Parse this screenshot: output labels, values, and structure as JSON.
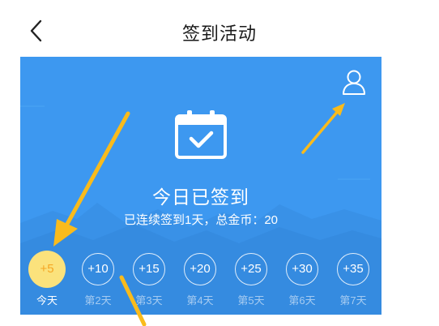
{
  "header": {
    "title": "签到活动",
    "back_icon": "chevron-left-icon"
  },
  "banner": {
    "background_color": "#3d98f0",
    "profile_icon": "user-icon",
    "calendar_icon": "calendar-check-icon",
    "status_title": "今日已签到",
    "status_subtitle": "已连续签到1天，总金币：20"
  },
  "days": [
    {
      "reward": "+5",
      "label": "今天",
      "active": true
    },
    {
      "reward": "+10",
      "label": "第2天",
      "active": false
    },
    {
      "reward": "+15",
      "label": "第3天",
      "active": false
    },
    {
      "reward": "+20",
      "label": "第4天",
      "active": false
    },
    {
      "reward": "+25",
      "label": "第5天",
      "active": false
    },
    {
      "reward": "+30",
      "label": "第6天",
      "active": false
    },
    {
      "reward": "+35",
      "label": "第7天",
      "active": false
    }
  ],
  "colors": {
    "active_day_bg": "#fbe27c",
    "active_day_text": "#f5a623",
    "annotation_arrow": "#f9bb1c"
  }
}
